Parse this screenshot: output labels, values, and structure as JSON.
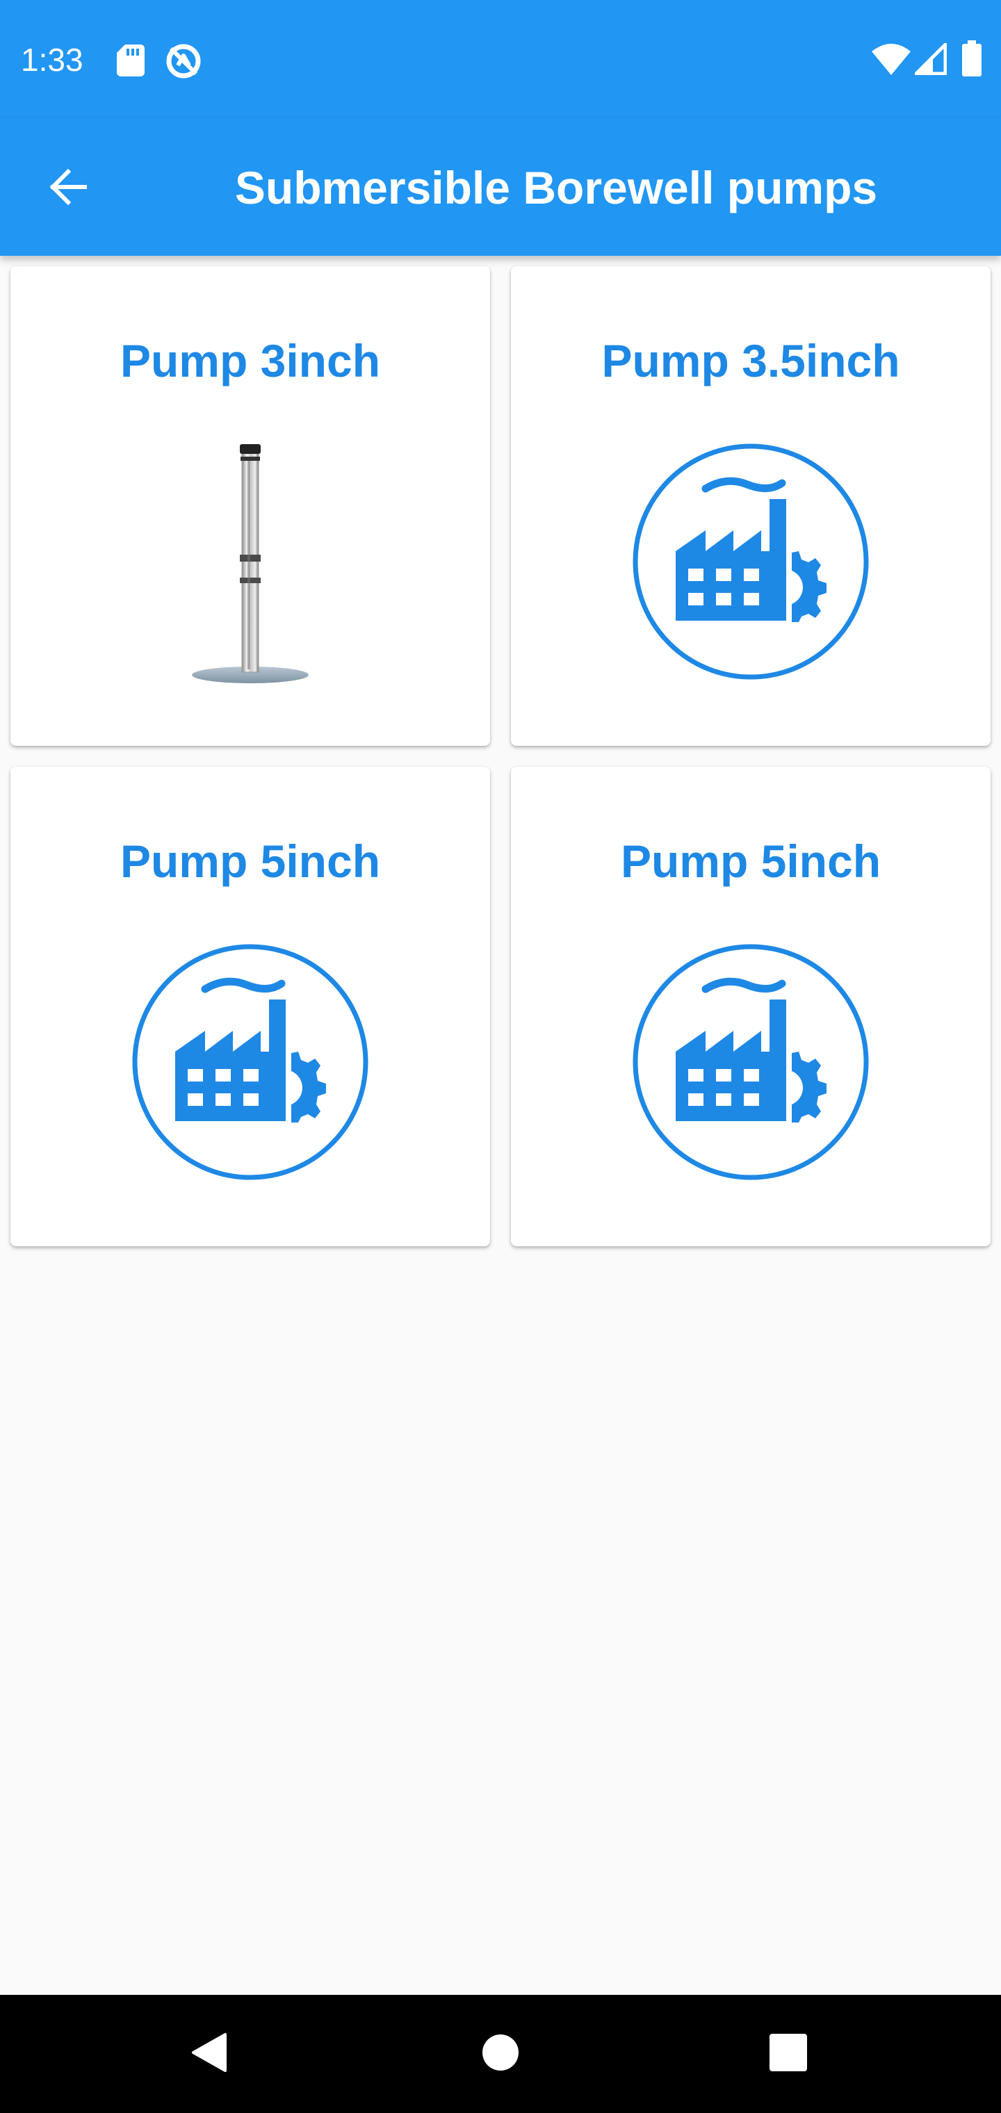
{
  "status_bar": {
    "time": "1:33",
    "icons": [
      "sd-card-icon",
      "data-saver-icon",
      "wifi-icon",
      "cellular-signal-icon",
      "battery-icon"
    ]
  },
  "app_bar": {
    "title": "Submersible Borewell pumps",
    "back_icon": "arrow-back-icon"
  },
  "products": [
    {
      "label": "Pump 3inch",
      "image": "borewell-pump-photo"
    },
    {
      "label": "Pump 3.5inch",
      "image": "factory-icon"
    },
    {
      "label": "Pump 5inch",
      "image": "factory-icon"
    },
    {
      "label": "Pump 5inch",
      "image": "factory-icon"
    }
  ],
  "nav_bar": {
    "buttons": [
      "back-triangle-icon",
      "home-circle-icon",
      "recents-square-icon"
    ]
  },
  "colors": {
    "primary": "#2196f3",
    "accent_text": "#1e88e5",
    "background": "#fafafa",
    "nav_bar": "#000000"
  }
}
